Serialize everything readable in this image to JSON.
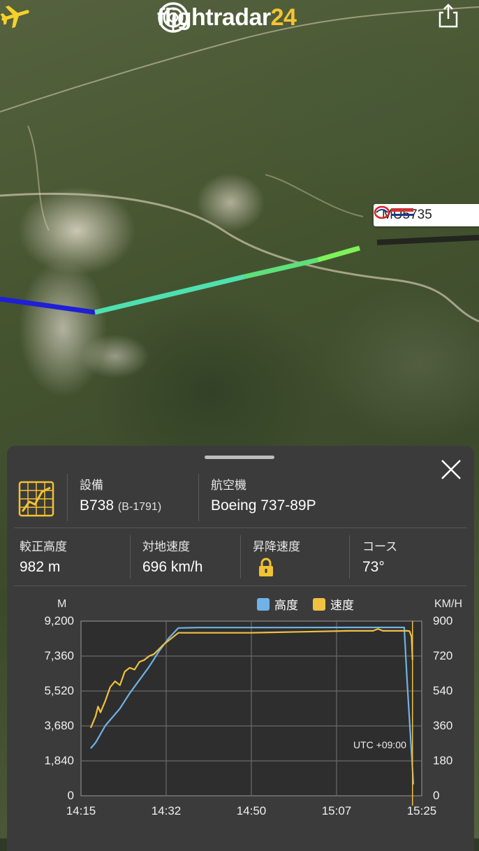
{
  "app": {
    "logo_text": "flightradar",
    "logo_number": "24"
  },
  "map": {
    "callsign": "MU5735",
    "airline_logo_icon": "china-eastern-logo-icon"
  },
  "panel": {
    "equipment": {
      "label": "設備",
      "type": "B738",
      "registration": "(B-1791)"
    },
    "aircraft": {
      "label": "航空機",
      "value": "Boeing 737-89P"
    },
    "stats": [
      {
        "label": "較正高度",
        "value": "982 m"
      },
      {
        "label": "対地速度",
        "value": "696 km/h"
      },
      {
        "label": "昇降速度",
        "value": "",
        "icon": "lock-icon"
      },
      {
        "label": "コース",
        "value": "73°"
      }
    ]
  },
  "chart_data": {
    "type": "line",
    "left_axis_unit": "M",
    "right_axis_unit": "KM/H",
    "timezone_note": "UTC +09:00",
    "x_ticks": [
      "14:15",
      "14:32",
      "14:50",
      "15:07",
      "15:25"
    ],
    "y_left_ticks": [
      "0",
      "1,840",
      "3,680",
      "5,520",
      "7,360",
      "9,200"
    ],
    "y_right_ticks": [
      "0",
      "180",
      "360",
      "540",
      "720",
      "900"
    ],
    "ylim_left": [
      0,
      9200
    ],
    "ylim_right": [
      0,
      900
    ],
    "xlim_minutes": [
      0,
      70
    ],
    "colors": {
      "altitude": "#6fb2e6",
      "speed": "#f0c040"
    },
    "series": [
      {
        "name": "高度",
        "axis": "left",
        "x": [
          2,
          3,
          5,
          8,
          10,
          12,
          14,
          16,
          18,
          20,
          22,
          24,
          28,
          40,
          55,
          65,
          66.4,
          67,
          68.3
        ],
        "values": [
          2500,
          2800,
          3700,
          4600,
          5400,
          6100,
          6800,
          7600,
          8300,
          8840,
          8850,
          8860,
          8860,
          8860,
          8870,
          8870,
          8870,
          6000,
          600
        ]
      },
      {
        "name": "速度",
        "axis": "right",
        "x": [
          2,
          3,
          3.5,
          4,
          5,
          6,
          7,
          8,
          9,
          10,
          11,
          12,
          13,
          14,
          15,
          17,
          19,
          20,
          21,
          22,
          25,
          35,
          45,
          55,
          60,
          61,
          62,
          64,
          66,
          67,
          67.5,
          67.9,
          68.1
        ],
        "values": [
          350,
          410,
          460,
          430,
          490,
          560,
          590,
          570,
          640,
          660,
          650,
          690,
          700,
          720,
          730,
          780,
          820,
          840,
          840,
          840,
          840,
          840,
          845,
          850,
          850,
          860,
          850,
          850,
          850,
          850,
          848,
          820,
          700
        ]
      }
    ]
  }
}
